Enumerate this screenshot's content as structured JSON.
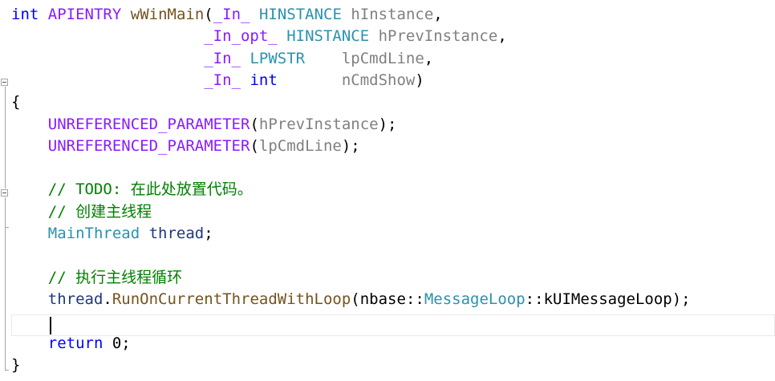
{
  "editor": {
    "lines": [
      {
        "tokens": [
          {
            "t": "int",
            "c": "kw"
          },
          {
            "t": " ",
            "c": "tx"
          },
          {
            "t": "APIENTRY",
            "c": "mac"
          },
          {
            "t": " ",
            "c": "tx"
          },
          {
            "t": "wWinMain",
            "c": "fn"
          },
          {
            "t": "(",
            "c": "tx"
          },
          {
            "t": "_In_",
            "c": "mac"
          },
          {
            "t": " ",
            "c": "tx"
          },
          {
            "t": "HINSTANCE",
            "c": "ty"
          },
          {
            "t": " ",
            "c": "tx"
          },
          {
            "t": "hInstance",
            "c": "par"
          },
          {
            "t": ",",
            "c": "tx"
          }
        ]
      },
      {
        "tokens": [
          {
            "t": "                     ",
            "c": "tx"
          },
          {
            "t": "_In_opt_",
            "c": "mac"
          },
          {
            "t": " ",
            "c": "tx"
          },
          {
            "t": "HINSTANCE",
            "c": "ty"
          },
          {
            "t": " ",
            "c": "tx"
          },
          {
            "t": "hPrevInstance",
            "c": "par"
          },
          {
            "t": ",",
            "c": "tx"
          }
        ]
      },
      {
        "tokens": [
          {
            "t": "                     ",
            "c": "tx"
          },
          {
            "t": "_In_",
            "c": "mac"
          },
          {
            "t": " ",
            "c": "tx"
          },
          {
            "t": "LPWSTR",
            "c": "ty"
          },
          {
            "t": "    ",
            "c": "tx"
          },
          {
            "t": "lpCmdLine",
            "c": "par"
          },
          {
            "t": ",",
            "c": "tx"
          }
        ]
      },
      {
        "tokens": [
          {
            "t": "                     ",
            "c": "tx"
          },
          {
            "t": "_In_",
            "c": "mac"
          },
          {
            "t": " ",
            "c": "tx"
          },
          {
            "t": "int",
            "c": "kw"
          },
          {
            "t": "       ",
            "c": "tx"
          },
          {
            "t": "nCmdShow",
            "c": "par"
          },
          {
            "t": ")",
            "c": "tx"
          }
        ]
      },
      {
        "tokens": [
          {
            "t": "{",
            "c": "tx"
          }
        ]
      },
      {
        "tokens": [
          {
            "t": "    ",
            "c": "tx"
          },
          {
            "t": "UNREFERENCED_PARAMETER",
            "c": "mac"
          },
          {
            "t": "(",
            "c": "tx"
          },
          {
            "t": "hPrevInstance",
            "c": "par"
          },
          {
            "t": ");",
            "c": "tx"
          }
        ]
      },
      {
        "tokens": [
          {
            "t": "    ",
            "c": "tx"
          },
          {
            "t": "UNREFERENCED_PARAMETER",
            "c": "mac"
          },
          {
            "t": "(",
            "c": "tx"
          },
          {
            "t": "lpCmdLine",
            "c": "par"
          },
          {
            "t": ");",
            "c": "tx"
          }
        ]
      },
      {
        "tokens": []
      },
      {
        "tokens": [
          {
            "t": "    ",
            "c": "tx"
          },
          {
            "t": "// TODO: 在此处放置代码。",
            "c": "cm"
          }
        ]
      },
      {
        "tokens": [
          {
            "t": "    ",
            "c": "tx"
          },
          {
            "t": "// 创建主线程",
            "c": "cm"
          }
        ]
      },
      {
        "tokens": [
          {
            "t": "    ",
            "c": "tx"
          },
          {
            "t": "MainThread",
            "c": "cls"
          },
          {
            "t": " ",
            "c": "tx"
          },
          {
            "t": "thread",
            "c": "var"
          },
          {
            "t": ";",
            "c": "tx"
          }
        ]
      },
      {
        "tokens": []
      },
      {
        "tokens": [
          {
            "t": "    ",
            "c": "tx"
          },
          {
            "t": "// 执行主线程循环",
            "c": "cm"
          }
        ]
      },
      {
        "tokens": [
          {
            "t": "    ",
            "c": "tx"
          },
          {
            "t": "thread",
            "c": "var"
          },
          {
            "t": ".",
            "c": "tx"
          },
          {
            "t": "RunOnCurrentThreadWithLoop",
            "c": "fn"
          },
          {
            "t": "(",
            "c": "tx"
          },
          {
            "t": "nbase",
            "c": "tx"
          },
          {
            "t": "::",
            "c": "tx"
          },
          {
            "t": "MessageLoop",
            "c": "cls"
          },
          {
            "t": "::",
            "c": "tx"
          },
          {
            "t": "kUIMessageLoop",
            "c": "tx"
          },
          {
            "t": ");",
            "c": "tx"
          }
        ]
      },
      {
        "tokens": []
      },
      {
        "tokens": [
          {
            "t": "    ",
            "c": "tx"
          },
          {
            "t": "return",
            "c": "kw"
          },
          {
            "t": " 0;",
            "c": "tx"
          }
        ]
      },
      {
        "tokens": [
          {
            "t": "}",
            "c": "tx"
          }
        ]
      }
    ]
  },
  "colors": {
    "keyword": "#0000ff",
    "type": "#2b91af",
    "function": "#74531f",
    "macro": "#8a1bff",
    "parameter": "#808080",
    "comment": "#008000",
    "variable": "#1f377f",
    "text": "#000000",
    "background": "#ffffff"
  }
}
